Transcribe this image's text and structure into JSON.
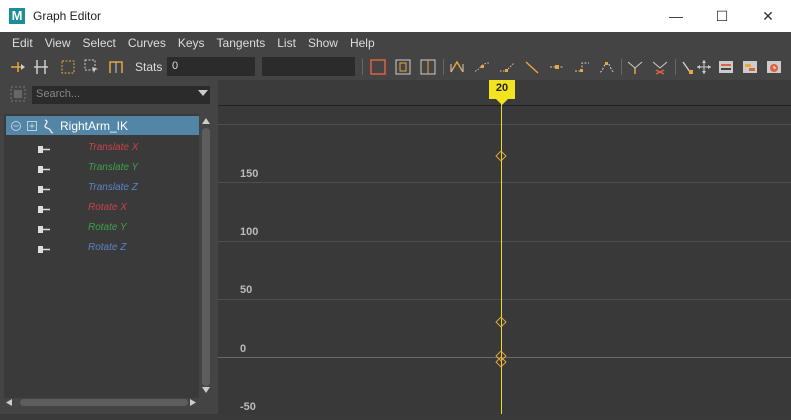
{
  "window": {
    "app_icon_letter": "M",
    "title": "Graph Editor",
    "minimize_glyph": "—",
    "maximize_glyph": "☐",
    "close_glyph": "✕"
  },
  "menu": [
    "Edit",
    "View",
    "Select",
    "Curves",
    "Keys",
    "Tangents",
    "List",
    "Show",
    "Help"
  ],
  "toolbar": {
    "stats_label": "Stats",
    "stats_value": "0",
    "stats_value2": ""
  },
  "outliner": {
    "search_placeholder": "Search...",
    "node": "RightArm_IK",
    "channels": [
      {
        "label": "Translate X",
        "color": "#c8434a"
      },
      {
        "label": "Translate Y",
        "color": "#3aa24a"
      },
      {
        "label": "Translate Z",
        "color": "#5a83c8"
      },
      {
        "label": "Rotate X",
        "color": "#c8434a"
      },
      {
        "label": "Rotate Y",
        "color": "#3aa24a"
      },
      {
        "label": "Rotate Z",
        "color": "#5a83c8"
      }
    ]
  },
  "graph": {
    "current_frame": "20",
    "y_ticks": [
      "150",
      "100",
      "50",
      "0",
      "-50"
    ],
    "cursor_color": "#f2e41e",
    "key_color": "#e8a73a"
  }
}
